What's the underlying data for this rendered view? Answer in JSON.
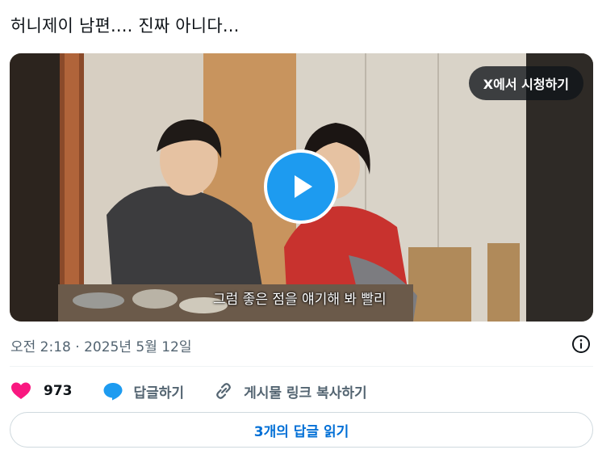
{
  "tweet": {
    "text": "허니제이 남편.... 진짜 아니다..."
  },
  "media": {
    "watch_label": "X에서 시청하기",
    "subtitle": "그럼 좋은 점을 얘기해 봐 빨리"
  },
  "meta": {
    "timestamp": "오전 2:18 · 2025년 5월 12일"
  },
  "actions": {
    "like_count": "973",
    "reply_label": "답글하기",
    "copy_link_label": "게시물 링크 복사하기"
  },
  "footer": {
    "read_replies_label": "3개의 답글 읽기"
  },
  "colors": {
    "accent": "#1d9bf0",
    "like": "#f91880",
    "link": "#006fd6",
    "muted": "#536471"
  },
  "icons": [
    "heart-icon",
    "speech-bubble-icon",
    "link-icon",
    "info-icon",
    "play-icon"
  ]
}
